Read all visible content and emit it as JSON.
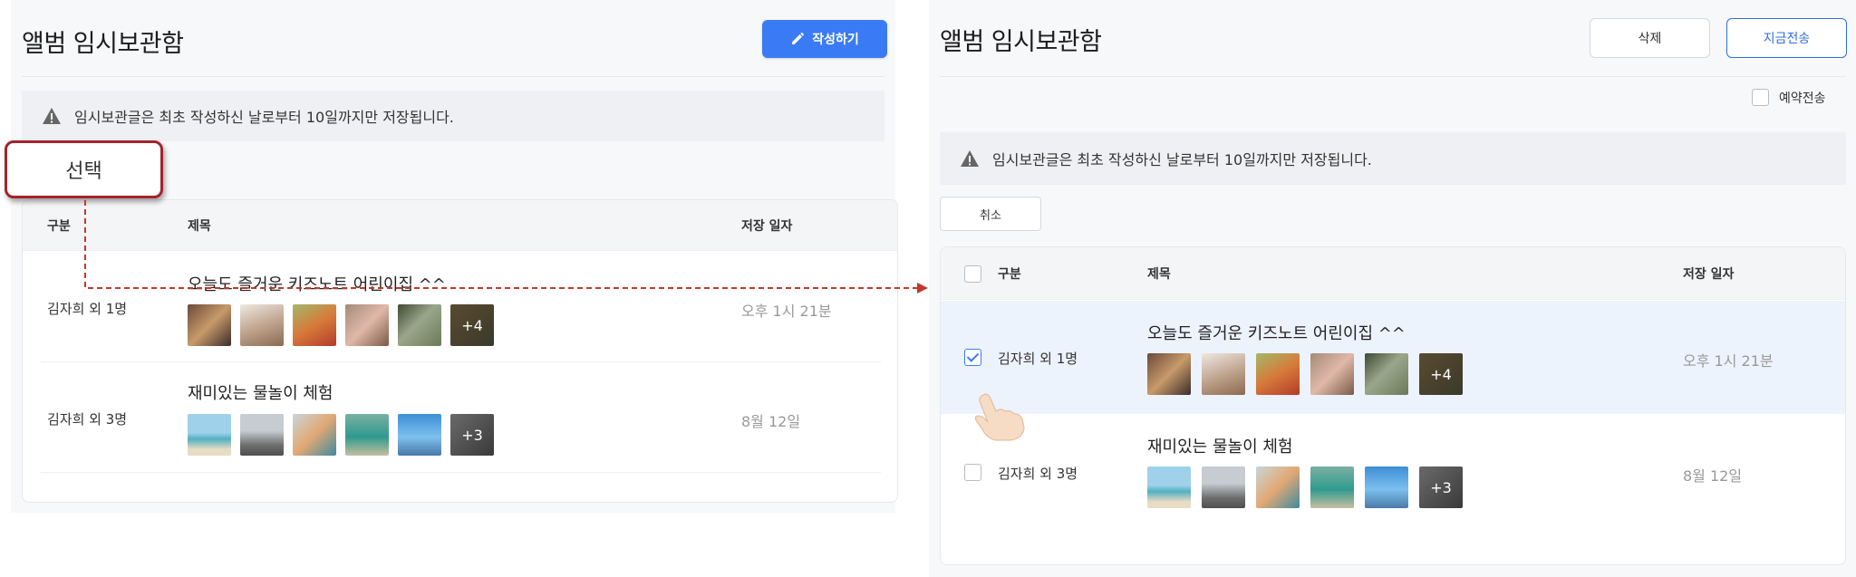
{
  "left": {
    "title": "앨범 임시보관함",
    "write_button": "작성하기",
    "notice": "임시보관글은 최초 작성하신 날로부터 10일까지만 저장됩니다.",
    "callout": "선택",
    "columns": [
      "구분",
      "제목",
      "저장 일자"
    ],
    "rows": [
      {
        "author": "김자희 외 1명",
        "title": "오늘도 즐거운 키즈노트 어린이집 ^^",
        "date": "오후 1시 21분",
        "more": "+4"
      },
      {
        "author": "김자희 외 3명",
        "title": "재미있는 물놀이 체험",
        "date": "8월 12일",
        "more": "+3"
      }
    ]
  },
  "right": {
    "title": "앨범 임시보관함",
    "delete_button": "삭제",
    "send_now_button": "지금전송",
    "reserve_label": "예약전송",
    "notice": "임시보관글은 최초 작성하신 날로부터 10일까지만 저장됩니다.",
    "cancel_button": "취소",
    "columns": [
      "구분",
      "제목",
      "저장 일자"
    ],
    "rows": [
      {
        "author": "김자희 외 1명",
        "title": "오늘도 즐거운 키즈노트 어린이집 ^^",
        "date": "오후 1시 21분",
        "more": "+4",
        "checked": true
      },
      {
        "author": "김자희 외 3명",
        "title": "재미있는 물놀이 체험",
        "date": "8월 12일",
        "more": "+3",
        "checked": false
      }
    ]
  },
  "colors": {
    "primary": "#3a7bf5",
    "callout_border": "#a3232b",
    "arrow": "#c0392b",
    "selected_row": "#edf3fd"
  }
}
